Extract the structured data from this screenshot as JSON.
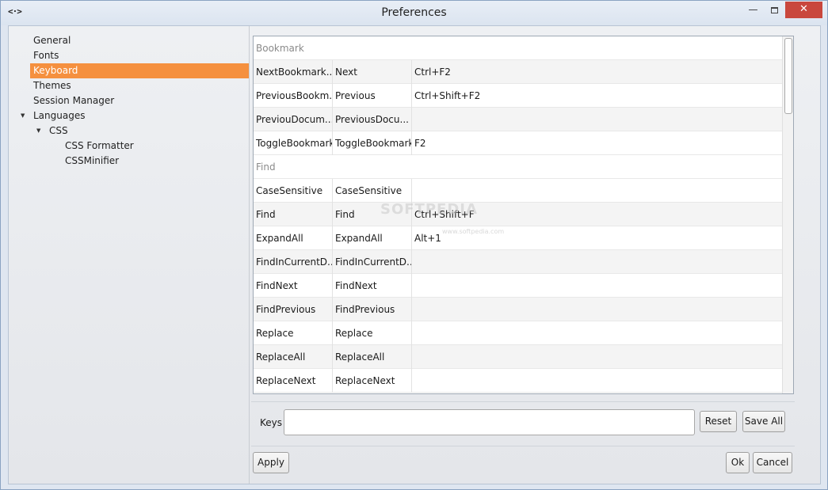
{
  "window": {
    "title": "Preferences",
    "icon": "code-icon",
    "icon_glyph": "<·>",
    "close_glyph": "✕",
    "minimize_glyph": "—"
  },
  "sidebar": {
    "items": [
      {
        "label": "General"
      },
      {
        "label": "Fonts"
      },
      {
        "label": "Keyboard",
        "selected": true
      },
      {
        "label": "Themes"
      },
      {
        "label": "Session Manager"
      },
      {
        "label": "Languages",
        "expanded": true
      },
      {
        "label": "CSS",
        "expanded": true
      },
      {
        "label": "CSS Formatter"
      },
      {
        "label": "CSSMinifier"
      }
    ]
  },
  "table": {
    "rows": [
      {
        "group": true,
        "name": "Bookmark"
      },
      {
        "name": "NextBookmark...",
        "title": "Next",
        "keys": "Ctrl+F2"
      },
      {
        "name": "PreviousBookm...",
        "title": "Previous",
        "keys": "Ctrl+Shift+F2"
      },
      {
        "name": "PreviouDocum...",
        "title": "PreviousDocu...",
        "keys": ""
      },
      {
        "name": "ToggleBookmark",
        "title": "ToggleBookmark",
        "keys": "F2"
      },
      {
        "group": true,
        "name": "Find"
      },
      {
        "name": "CaseSensitive",
        "title": "CaseSensitive",
        "keys": ""
      },
      {
        "name": "Find",
        "title": "Find",
        "keys": "Ctrl+Shift+F"
      },
      {
        "name": "ExpandAll",
        "title": "ExpandAll",
        "keys": "Alt+1"
      },
      {
        "name": "FindInCurrentD...",
        "title": "FindInCurrentD...",
        "keys": ""
      },
      {
        "name": "FindNext",
        "title": "FindNext",
        "keys": ""
      },
      {
        "name": "FindPrevious",
        "title": "FindPrevious",
        "keys": ""
      },
      {
        "name": "Replace",
        "title": "Replace",
        "keys": ""
      },
      {
        "name": "ReplaceAll",
        "title": "ReplaceAll",
        "keys": ""
      },
      {
        "name": "ReplaceNext",
        "title": "ReplaceNext",
        "keys": ""
      }
    ]
  },
  "watermark": {
    "text": "SOFTPEDIA",
    "sub": "www.softpedia.com"
  },
  "keys": {
    "label": "Keys",
    "value": "",
    "placeholder": ""
  },
  "buttons": {
    "reset": "Reset",
    "save_all": "Save All",
    "apply": "Apply",
    "ok": "Ok",
    "cancel": "Cancel"
  }
}
